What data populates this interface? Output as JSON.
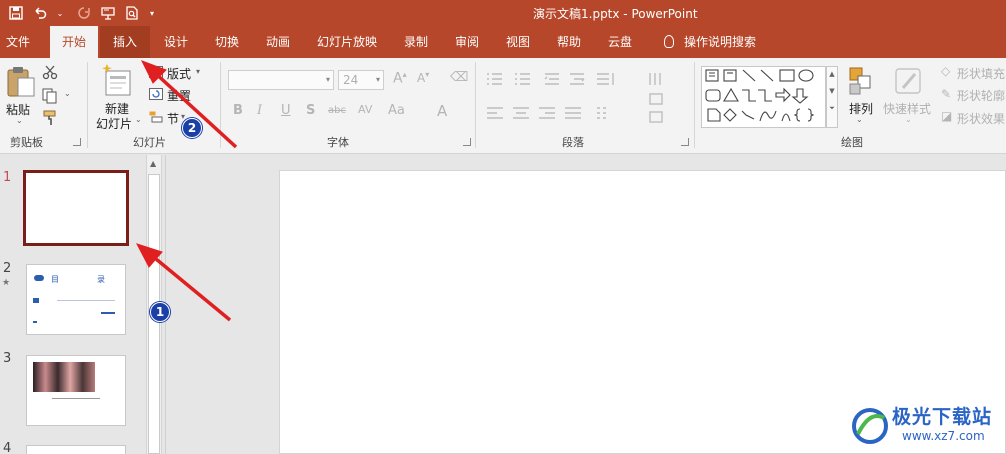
{
  "window": {
    "title": "演示文稿1.pptx  -  PowerPoint"
  },
  "qat": {
    "icons": [
      "save-icon",
      "undo-icon",
      "redo-icon",
      "present-icon",
      "print-preview-icon",
      "customize-icon"
    ]
  },
  "tabs": [
    {
      "id": "file",
      "label": "文件"
    },
    {
      "id": "home",
      "label": "开始"
    },
    {
      "id": "insert",
      "label": "插入"
    },
    {
      "id": "design",
      "label": "设计"
    },
    {
      "id": "transitions",
      "label": "切换"
    },
    {
      "id": "animations",
      "label": "动画"
    },
    {
      "id": "slideshow",
      "label": "幻灯片放映"
    },
    {
      "id": "record",
      "label": "录制"
    },
    {
      "id": "review",
      "label": "审阅"
    },
    {
      "id": "view",
      "label": "视图"
    },
    {
      "id": "help",
      "label": "帮助"
    },
    {
      "id": "cloud",
      "label": "云盘"
    },
    {
      "id": "tellme",
      "label": "操作说明搜索"
    }
  ],
  "ribbon": {
    "clipboard": {
      "label": "剪贴板",
      "paste": "粘贴"
    },
    "slides": {
      "label": "幻灯片",
      "new_slide_line1": "新建",
      "new_slide_line2": "幻灯片",
      "layout": "版式",
      "reset": "重置",
      "section": "节"
    },
    "font": {
      "label": "字体",
      "size": "24",
      "bold": "B",
      "italic": "I",
      "underline": "U",
      "shadow": "S",
      "strike": "abc",
      "spacing": "AV",
      "case": "Aa",
      "color": "A"
    },
    "paragraph": {
      "label": "段落"
    },
    "drawing": {
      "label": "绘图",
      "arrange": "排列",
      "quick_styles": "快速样式",
      "shape_fill": "形状填充",
      "shape_outline": "形状轮廓",
      "shape_effects": "形状效果"
    }
  },
  "slides": [
    {
      "number": "1",
      "selected": true
    },
    {
      "number": "2",
      "star": "★",
      "title_left": "目",
      "title_right": "录"
    },
    {
      "number": "3"
    },
    {
      "number": "4"
    }
  ],
  "annotations": {
    "badge1": "1",
    "badge2": "2"
  },
  "watermark": {
    "brand": "极光下载站",
    "url": "www.xz7.com"
  },
  "colors": {
    "accent": "#b7472a",
    "selection": "#7a1e18",
    "arrow": "#e02020",
    "badge": "#1a3fa6"
  }
}
